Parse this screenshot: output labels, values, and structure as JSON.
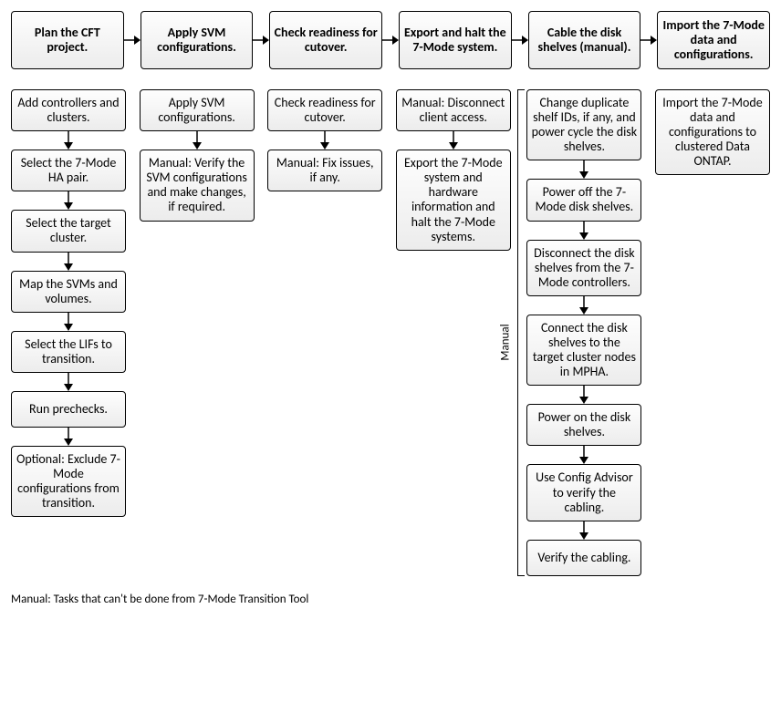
{
  "top": [
    "Plan the CFT project.",
    "Apply SVM configurations.",
    "Check readiness for cutover.",
    "Export and halt the 7-Mode system.",
    "Cable the disk shelves (manual).",
    "Import the 7-Mode data and configurations."
  ],
  "cols": {
    "c1": [
      "Add controllers and clusters.",
      "Select the 7-Mode HA pair.",
      "Select the target cluster.",
      "Map the SVMs and volumes.",
      "Select the LIFs to transition.",
      "Run prechecks.",
      "Optional: Exclude 7-Mode configurations from transition."
    ],
    "c2": [
      "Apply SVM configurations.",
      "Manual: Verify the SVM configurations and make changes, if required."
    ],
    "c3": [
      "Check readiness for cutover.",
      "Manual: Fix issues, if any."
    ],
    "c4": [
      "Manual: Disconnect client access.",
      "Export the 7-Mode system and hardware information and halt the 7-Mode systems."
    ],
    "c5": [
      "Change duplicate shelf IDs, if any, and power cycle the disk shelves.",
      "Power off the 7-Mode disk shelves.",
      "Disconnect the disk shelves from the 7-Mode controllers.",
      "Connect the disk shelves to the target cluster nodes in MPHA.",
      "Power on the disk shelves.",
      "Use Config Advisor to verify the cabling.",
      "Verify the cabling."
    ],
    "c6": [
      "Import the 7-Mode data and configurations to clustered Data ONTAP."
    ]
  },
  "manual_label": "Manual",
  "footnote": "Manual: Tasks that can't be done from 7-Mode Transition Tool"
}
